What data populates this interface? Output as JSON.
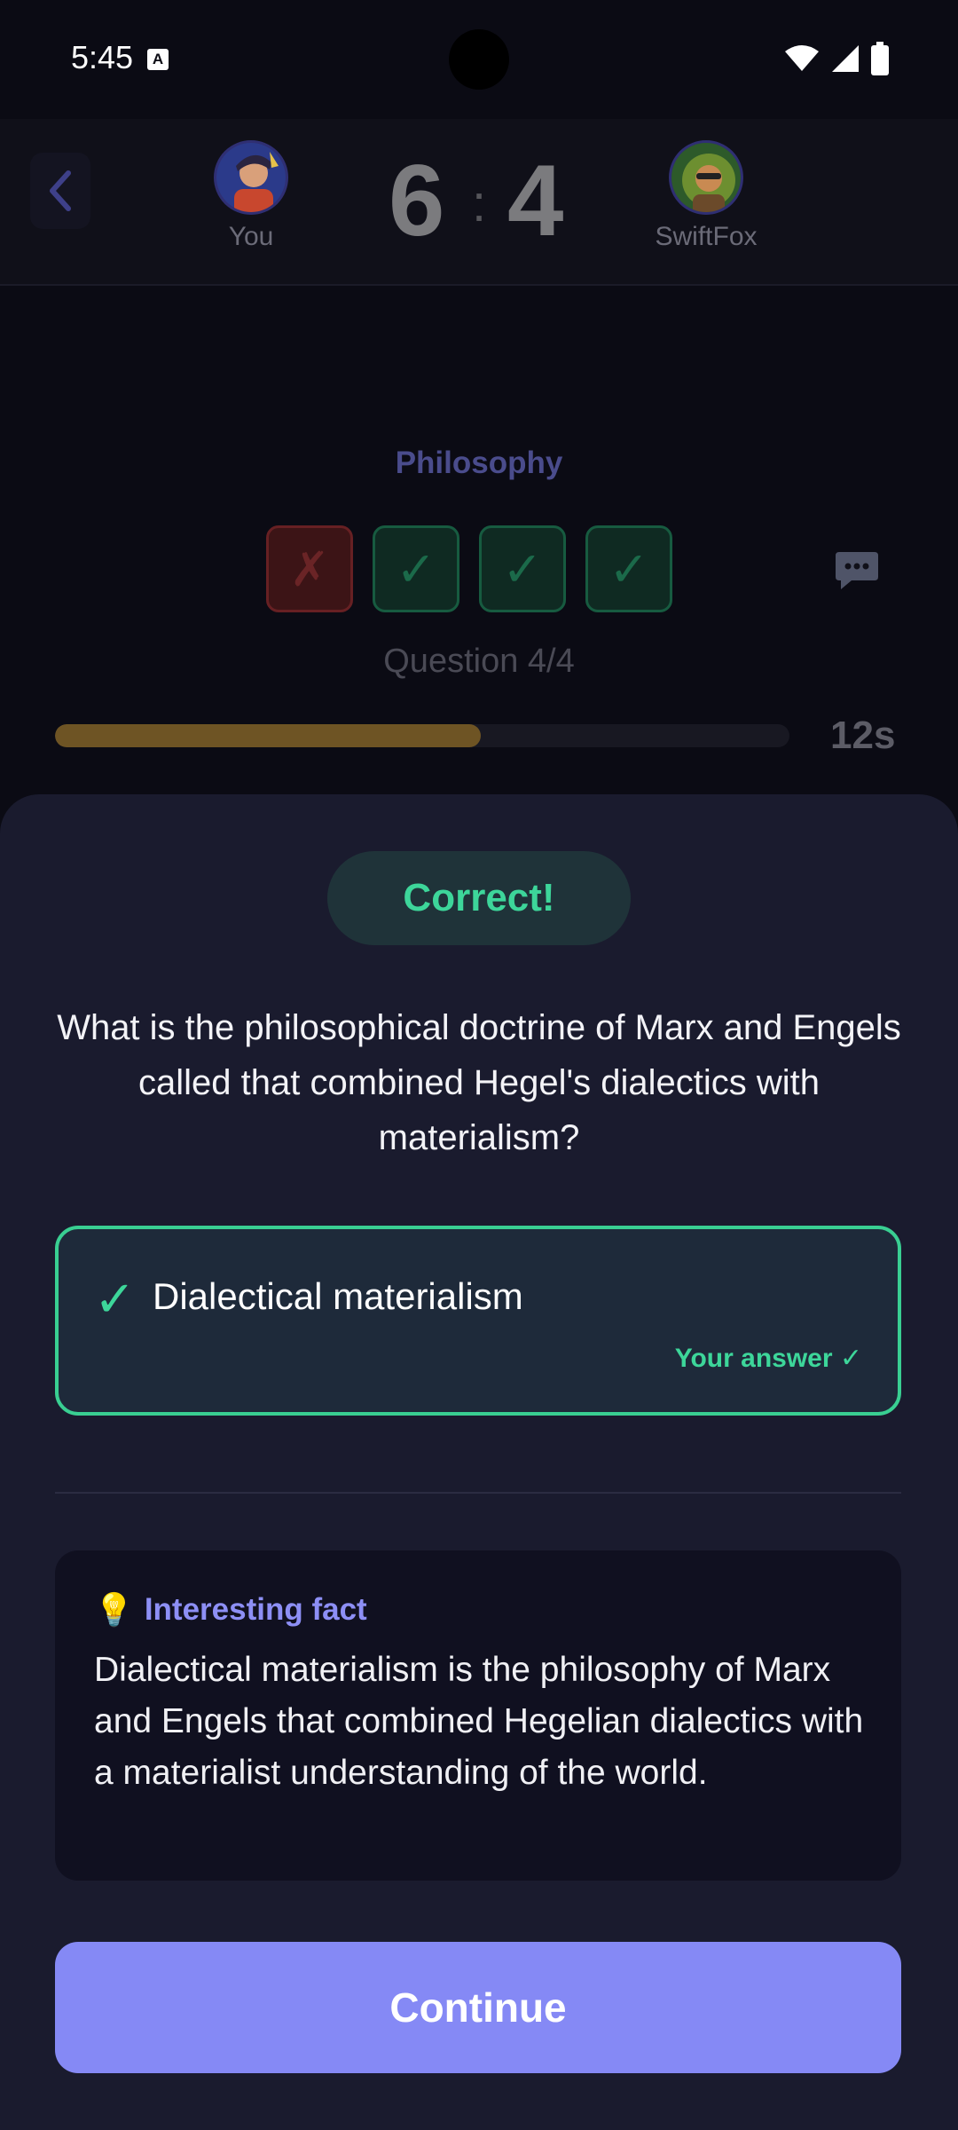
{
  "status_bar": {
    "time": "5:45",
    "notification_icon": "A"
  },
  "header": {
    "player_left": {
      "name": "You",
      "score": "6"
    },
    "player_right": {
      "name": "SwiftFox",
      "score": "4"
    },
    "score_separator": ":"
  },
  "quiz": {
    "category": "Philosophy",
    "question_results": [
      "✗",
      "✓",
      "✓",
      "✓"
    ],
    "question_counter": "Question 4/4",
    "timer": "12s",
    "timer_progress_fraction": 0.58
  },
  "result": {
    "badge": "Correct!",
    "question": "What is the philosophical doctrine of Marx and Engels called that combined Hegel's dialectics with materialism?",
    "answer": {
      "check": "✓",
      "text": "Dialectical materialism",
      "tag": "Your answer ✓"
    },
    "fact": {
      "icon": "💡",
      "title": "Interesting fact",
      "text": "Dialectical materialism is the philosophy of Marx and Engels that combined Hegelian dialectics with a materialist understanding of the world."
    },
    "continue_label": "Continue"
  },
  "colors": {
    "accent": "#8589f5",
    "success": "#3dd69a",
    "error": "#672023",
    "timer_bar": "#6e5424"
  }
}
